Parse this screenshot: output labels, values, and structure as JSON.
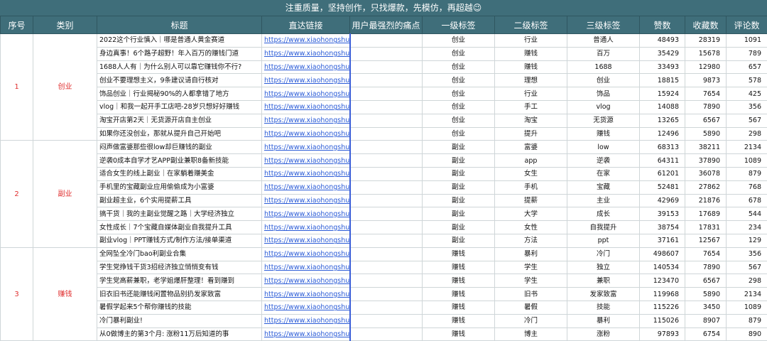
{
  "banner": "注重质量，坚持创作，只找爆款，先模仿，再超越",
  "banner_emoji": "😉",
  "headers": [
    "序号",
    "类别",
    "标题",
    "直达链接",
    "用户最强烈的痛点",
    "一级标签",
    "二级标签",
    "三级标签",
    "赞数",
    "收藏数",
    "评论数"
  ],
  "groups": [
    {
      "index": "1",
      "category": "创业",
      "rows": [
        {
          "title": "2022这个行业慎入｜哪是普通人黄金赛道",
          "link": "https://www.xiaohongshu.com",
          "pain": "",
          "l1": "创业",
          "l2": "行业",
          "l3": "普通人",
          "likes": "48493",
          "saves": "28319",
          "comments": "1091"
        },
        {
          "title": "身边真事！6个路子超野！年入百万的赚钱门道",
          "link": "https://www.xiaohongshu.com",
          "pain": "",
          "l1": "创业",
          "l2": "赚钱",
          "l3": "百万",
          "likes": "35429",
          "saves": "15678",
          "comments": "789"
        },
        {
          "title": "1688人人有｜为什么别人可以靠它赚钱你不行?",
          "link": "https://www.xiaohongshu.com",
          "pain": "",
          "l1": "创业",
          "l2": "赚钱",
          "l3": "1688",
          "likes": "33493",
          "saves": "12980",
          "comments": "657"
        },
        {
          "title": "创业不要理想主义，9条建议请自行核对",
          "link": "https://www.xiaohongshu.com",
          "pain": "",
          "l1": "创业",
          "l2": "理想",
          "l3": "创业",
          "likes": "18815",
          "saves": "9873",
          "comments": "578"
        },
        {
          "title": "饰品创业｜行业揭秘90%的人都拿错了地方",
          "link": "https://www.xiaohongshu.com",
          "pain": "",
          "l1": "创业",
          "l2": "行业",
          "l3": "饰品",
          "likes": "15924",
          "saves": "7654",
          "comments": "425"
        },
        {
          "title": "vlog｜和我一起开手工店吧-28岁只想好好赚钱",
          "link": "https://www.xiaohongshu.com",
          "pain": "",
          "l1": "创业",
          "l2": "手工",
          "l3": "vlog",
          "likes": "14088",
          "saves": "7890",
          "comments": "356"
        },
        {
          "title": "淘宝开店第2天｜无货源开店自主创业",
          "link": "https://www.xiaohongshu.com",
          "pain": "",
          "l1": "创业",
          "l2": "淘宝",
          "l3": "无货源",
          "likes": "13265",
          "saves": "6567",
          "comments": "567"
        },
        {
          "title": "如果你还没创业，那就从提升自己开始吧",
          "link": "https://www.xiaohongshu.com",
          "pain": "",
          "l1": "创业",
          "l2": "提升",
          "l3": "赚钱",
          "likes": "12496",
          "saves": "5890",
          "comments": "298"
        }
      ]
    },
    {
      "index": "2",
      "category": "副业",
      "rows": [
        {
          "title": "闷声做富婆那些很low却巨赚钱的副业",
          "link": "https://www.xiaohongshu.com",
          "pain": "",
          "l1": "副业",
          "l2": "富婆",
          "l3": "low",
          "likes": "68313",
          "saves": "38211",
          "comments": "2134"
        },
        {
          "title": "逆袭0成本自学才艺APP副业兼职8备新技能",
          "link": "https://www.xiaohongshu.com",
          "pain": "",
          "l1": "副业",
          "l2": "app",
          "l3": "逆袭",
          "likes": "64311",
          "saves": "37890",
          "comments": "1089"
        },
        {
          "title": "适合女生的线上副业｜在家躺着赚美金",
          "link": "https://www.xiaohongshu.com",
          "pain": "",
          "l1": "副业",
          "l2": "女生",
          "l3": "在家",
          "likes": "61201",
          "saves": "36078",
          "comments": "879"
        },
        {
          "title": "手机里的宝藏副业应用偷偷成为小富婆",
          "link": "https://www.xiaohongshu.com",
          "pain": "",
          "l1": "副业",
          "l2": "手机",
          "l3": "宝藏",
          "likes": "52481",
          "saves": "27862",
          "comments": "768"
        },
        {
          "title": "副业超主业，6个实用提薪工具",
          "link": "https://www.xiaohongshu.com",
          "pain": "",
          "l1": "副业",
          "l2": "提薪",
          "l3": "主业",
          "likes": "42969",
          "saves": "21876",
          "comments": "678"
        },
        {
          "title": "搞干货｜我的主副业觉醒之路｜大学经济独立",
          "link": "https://www.xiaohongshu.com",
          "pain": "",
          "l1": "副业",
          "l2": "大学",
          "l3": "成长",
          "likes": "39153",
          "saves": "17689",
          "comments": "544"
        },
        {
          "title": "女性成长｜7个宝藏自媒体副业自我提升工具",
          "link": "https://www.xiaohongshu.com",
          "pain": "",
          "l1": "副业",
          "l2": "女性",
          "l3": "自我提升",
          "likes": "38754",
          "saves": "17831",
          "comments": "234"
        },
        {
          "title": "副业vlog｜PPT赚钱方式/制作方法/接单渠道",
          "link": "https://www.xiaohongshu.com",
          "pain": "",
          "l1": "副业",
          "l2": "方法",
          "l3": "ppt",
          "likes": "37161",
          "saves": "12567",
          "comments": "129"
        }
      ]
    },
    {
      "index": "3",
      "category": "赚钱",
      "rows": [
        {
          "title": "全网坠全冷门bao利副业合集",
          "link": "https://www.xiaohongshu.com",
          "pain": "",
          "l1": "赚钱",
          "l2": "暴利",
          "l3": "冷门",
          "likes": "498607",
          "saves": "7654",
          "comments": "356"
        },
        {
          "title": "学生党挣钱干货3招经济独立悄悄变有钱",
          "link": "https://www.xiaohongshu.com",
          "pain": "",
          "l1": "赚钱",
          "l2": "学生",
          "l3": "独立",
          "likes": "140534",
          "saves": "7890",
          "comments": "567"
        },
        {
          "title": "学生党高薪兼职，老学姐爆肝整理！看到赚到",
          "link": "https://www.xiaohongshu.com",
          "pain": "",
          "l1": "赚钱",
          "l2": "学生",
          "l3": "兼职",
          "likes": "123470",
          "saves": "6567",
          "comments": "298"
        },
        {
          "title": "旧衣旧书还能赚钱闲置物品别扔发家致富",
          "link": "https://www.xiaohongshu.com",
          "pain": "",
          "l1": "赚钱",
          "l2": "旧书",
          "l3": "发家致富",
          "likes": "119968",
          "saves": "5890",
          "comments": "2134"
        },
        {
          "title": "暑假学起来5个帮你赚钱的技能",
          "link": "https://www.xiaohongshu.com",
          "pain": "",
          "l1": "赚钱",
          "l2": "暑假",
          "l3": "技能",
          "likes": "115226",
          "saves": "3450",
          "comments": "1089"
        },
        {
          "title": "冷门暴利副业!",
          "link": "https://www.xiaohongshu.com",
          "pain": "",
          "l1": "赚钱",
          "l2": "冷门",
          "l3": "暴利",
          "likes": "115026",
          "saves": "8907",
          "comments": "879"
        },
        {
          "title": "从0做博主的第3个月: 涨粉11万后知道的事",
          "link": "https://www.xiaohongshu.com",
          "pain": "",
          "l1": "赚钱",
          "l2": "博主",
          "l3": "涨粉",
          "likes": "97893",
          "saves": "6754",
          "comments": "890"
        }
      ]
    }
  ]
}
